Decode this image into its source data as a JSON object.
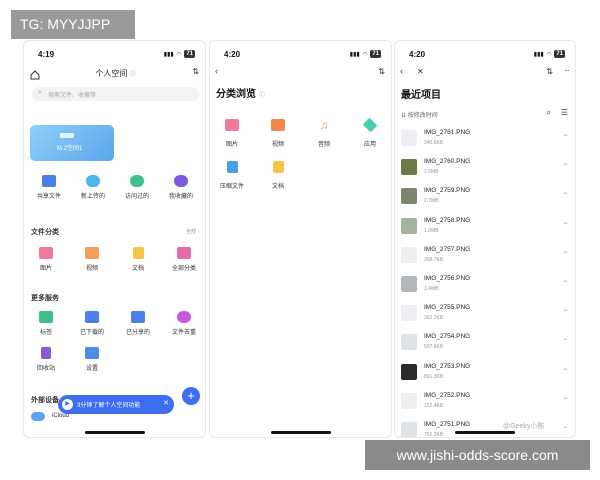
{
  "overlay": {
    "tag": "TG: MYYJJPP",
    "watermark": "www.jishi-odds-score.com",
    "weibo": "@Geeky小陈"
  },
  "screen1": {
    "time": "4:19",
    "battery": "71",
    "title": "个人空间",
    "search_placeholder": "搜索文件、收藏等",
    "banner_text": "M.2空间1",
    "quick": [
      {
        "label": "共享文件",
        "icon": "share-folder-icon",
        "color": "#4a7ee8"
      },
      {
        "label": "新上传的",
        "icon": "cloud-upload-icon",
        "color": "#4ab8e8"
      },
      {
        "label": "访问过的",
        "icon": "clock-icon",
        "color": "#3fbf8a"
      },
      {
        "label": "我收藏的",
        "icon": "star-icon",
        "color": "#7a5ae0"
      }
    ],
    "category_header": "文件分类",
    "category_more": "全部 ›",
    "categories": [
      {
        "label": "图片",
        "icon": "image-icon",
        "color": "#f07a9a"
      },
      {
        "label": "视频",
        "icon": "video-icon",
        "color": "#f5a05a"
      },
      {
        "label": "文档",
        "icon": "document-icon",
        "color": "#f5c44a"
      },
      {
        "label": "全部分类",
        "icon": "all-category-icon",
        "color": "#e86ab0"
      }
    ],
    "services_header": "更多服务",
    "services": [
      {
        "label": "标签",
        "icon": "tag-icon",
        "color": "#3fbf8a"
      },
      {
        "label": "已下载的",
        "icon": "download-icon",
        "color": "#4a7ee8"
      },
      {
        "label": "已分享的",
        "icon": "shared-icon",
        "color": "#4a7ee8"
      },
      {
        "label": "文件去重",
        "icon": "dedupe-icon",
        "color": "#c45ae0"
      },
      {
        "label": "回收站",
        "icon": "trash-icon",
        "color": "#8a5ad8"
      },
      {
        "label": "设置",
        "icon": "settings-icon",
        "color": "#4a8ee8"
      }
    ],
    "devices_header": "外部设备",
    "device_name": "iCloud",
    "toast": "3分钟了解个人空间功能",
    "fab": "+"
  },
  "screen2": {
    "time": "4:20",
    "battery": "71",
    "title": "分类浏览",
    "categories": [
      {
        "label": "图片",
        "icon": "image-icon",
        "color": "#f07a9a"
      },
      {
        "label": "视频",
        "icon": "video-icon",
        "color": "#f5844a"
      },
      {
        "label": "音频",
        "icon": "audio-icon",
        "color": "#f5a84a"
      },
      {
        "label": "应用",
        "icon": "app-icon",
        "color": "#4acfb0"
      },
      {
        "label": "压缩文件",
        "icon": "archive-icon",
        "color": "#4a9ee8"
      },
      {
        "label": "文档",
        "icon": "document-icon",
        "color": "#f5c44a"
      }
    ]
  },
  "screen3": {
    "time": "4:20",
    "battery": "71",
    "title": "最近项目",
    "sort_label": "按修改时间",
    "files": [
      {
        "name": "IMG_2761.PNG",
        "size": "340.6KB",
        "thumb": "#eceef1"
      },
      {
        "name": "IMG_2760.PNG",
        "size": "2.6MB",
        "thumb": "#6d7a4a"
      },
      {
        "name": "IMG_2759.PNG",
        "size": "2.7MB",
        "thumb": "#7d8570"
      },
      {
        "name": "IMG_2758.PNG",
        "size": "1.8MB",
        "thumb": "#a6b3a0"
      },
      {
        "name": "IMG_2757.PNG",
        "size": "308.7KB",
        "thumb": "#eceef1"
      },
      {
        "name": "IMG_2756.PNG",
        "size": "1.4MB",
        "thumb": "#b3b8bd"
      },
      {
        "name": "IMG_2755.PNG",
        "size": "362.2KB",
        "thumb": "#eceef1"
      },
      {
        "name": "IMG_2754.PNG",
        "size": "507.6KB",
        "thumb": "#dfe2e6"
      },
      {
        "name": "IMG_2753.PNG",
        "size": "861.3KB",
        "thumb": "#2a2a2a"
      },
      {
        "name": "IMG_2752.PNG",
        "size": "152.4KB",
        "thumb": "#eceef1"
      },
      {
        "name": "IMG_2751.PNG",
        "size": "792.2KB",
        "thumb": "#dfe2e6"
      }
    ]
  }
}
